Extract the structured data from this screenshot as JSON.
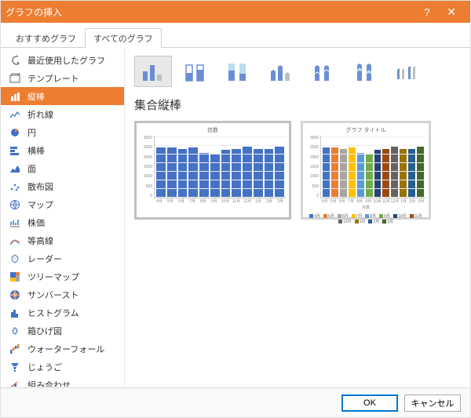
{
  "title": "グラフの挿入",
  "tabs": {
    "rec": "おすすめグラフ",
    "all": "すべてのグラフ"
  },
  "sidebar": [
    "最近使用したグラフ",
    "テンプレート",
    "縦棒",
    "折れ線",
    "円",
    "横棒",
    "面",
    "散布図",
    "マップ",
    "株価",
    "等高線",
    "レーダー",
    "ツリーマップ",
    "サンバースト",
    "ヒストグラム",
    "箱ひげ図",
    "ウォーターフォール",
    "じょうご",
    "組み合わせ"
  ],
  "chart_name": "集合縦棒",
  "buttons": {
    "ok": "OK",
    "cancel": "キャンセル"
  },
  "chart_data": [
    {
      "type": "bar",
      "title": "信数",
      "categories": [
        "4月",
        "5月",
        "6月",
        "7月",
        "8月",
        "9月",
        "10月",
        "11月",
        "12月",
        "1月",
        "2月",
        "3月"
      ],
      "values": [
        2450,
        2450,
        2400,
        2450,
        2200,
        2150,
        2350,
        2400,
        2500,
        2400,
        2400,
        2500
      ],
      "ylim": [
        0,
        3000
      ],
      "yticks": [
        0,
        500,
        1000,
        1500,
        2000,
        2500,
        3000
      ],
      "xlabel": "",
      "ylabel": ""
    },
    {
      "type": "bar",
      "title": "グラフ タイトル",
      "categories": [
        "4月",
        "5月",
        "6月",
        "7月",
        "8月",
        "9月",
        "10月",
        "11月",
        "12月",
        "1月",
        "2月",
        "3月"
      ],
      "values": [
        2450,
        2450,
        2400,
        2450,
        2200,
        2150,
        2350,
        2400,
        2500,
        2400,
        2400,
        2500
      ],
      "colors": [
        "#4472c4",
        "#ed7d31",
        "#a5a5a5",
        "#ffc000",
        "#5b9bd5",
        "#70ad47",
        "#264478",
        "#9e480e",
        "#636363",
        "#997300",
        "#255e91",
        "#43682b"
      ],
      "ylim": [
        0,
        3000
      ],
      "yticks": [
        0,
        500,
        1000,
        1500,
        2000,
        2500,
        3000
      ],
      "xlabel": "信数",
      "ylabel": ""
    }
  ]
}
